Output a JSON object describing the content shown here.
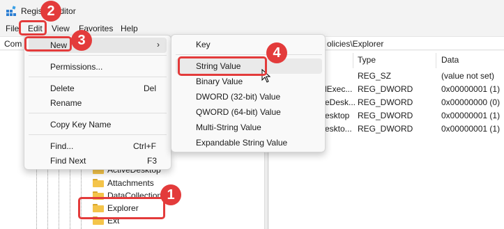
{
  "window": {
    "title": "Registry Editor"
  },
  "menubar": {
    "items": [
      "File",
      "Edit",
      "View",
      "Favorites",
      "Help"
    ]
  },
  "addressbar": {
    "left_text": "Com",
    "right_text": "olicies\\Explorer"
  },
  "tree": {
    "items": [
      {
        "label": "ActiveDesktop"
      },
      {
        "label": "Attachments"
      },
      {
        "label": "DataCollection"
      },
      {
        "label": "Explorer",
        "selected": true
      },
      {
        "label": "Ext"
      }
    ]
  },
  "values_pane": {
    "columns": [
      "Type",
      "Data"
    ],
    "rows": [
      {
        "name": "",
        "type": "REG_SZ",
        "data": "(value not set)"
      },
      {
        "name": "lExec...",
        "type": "REG_DWORD",
        "data": "0x00000001 (1)"
      },
      {
        "name": "eDesk...",
        "type": "REG_DWORD",
        "data": "0x00000000 (0)"
      },
      {
        "name": "esktop",
        "type": "REG_DWORD",
        "data": "0x00000001 (1)"
      },
      {
        "name": "eskto...",
        "type": "REG_DWORD",
        "data": "0x00000001 (1)"
      }
    ]
  },
  "edit_menu": {
    "new_label": "New",
    "permissions_label": "Permissions...",
    "delete_label": "Delete",
    "delete_shortcut": "Del",
    "rename_label": "Rename",
    "copy_key_name_label": "Copy Key Name",
    "find_label": "Find...",
    "find_shortcut": "Ctrl+F",
    "find_next_label": "Find Next",
    "find_next_shortcut": "F3"
  },
  "new_submenu": {
    "items": [
      "Key",
      "String Value",
      "Binary Value",
      "DWORD (32-bit) Value",
      "QWORD (64-bit) Value",
      "Multi-String Value",
      "Expandable String Value"
    ]
  },
  "annotations": [
    "1",
    "2",
    "3",
    "4"
  ],
  "colors": {
    "annotation": "#e33b3b",
    "folder": "#f4c44a",
    "menu_bg": "#f9f9f9"
  }
}
